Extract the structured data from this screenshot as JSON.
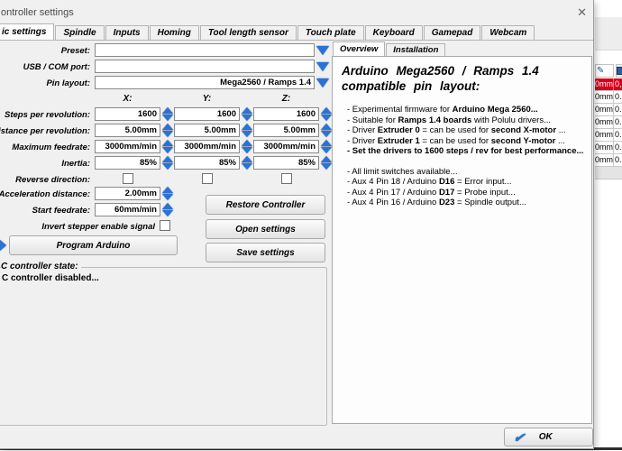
{
  "window": {
    "title": "ontroller settings",
    "close_glyph": "✕"
  },
  "tabs": [
    "ic settings",
    "Spindle",
    "Inputs",
    "Homing",
    "Tool length sensor",
    "Touch plate",
    "Keyboard",
    "Gamepad",
    "Webcam"
  ],
  "form": {
    "preset_label": "Preset:",
    "usb_label": "USB / COM port:",
    "pin_label": "Pin layout:",
    "preset_value": "",
    "usb_value": "",
    "pin_value": "Mega2560 / Ramps 1.4",
    "col_headers": [
      "X:",
      "Y:",
      "Z:"
    ],
    "rows": [
      {
        "label": "Steps per revolution:",
        "values": [
          "1600",
          "1600",
          "1600"
        ]
      },
      {
        "label": "Distance per revolution:",
        "values": [
          "5.00mm",
          "5.00mm",
          "5.00mm"
        ]
      },
      {
        "label": "Maximum feedrate:",
        "values": [
          "3000mm/min",
          "3000mm/min",
          "3000mm/min"
        ]
      },
      {
        "label": "Inertia:",
        "values": [
          "85%",
          "85%",
          "85%"
        ]
      }
    ],
    "reverse_label": "Reverse direction:",
    "accel_label": "Acceleration distance:",
    "accel_value": "2.00mm",
    "start_label": "Start feedrate:",
    "start_value": "60mm/min",
    "invert_label": "Invert stepper enable signal",
    "program_button": "Program Arduino",
    "restore_button": "Restore Controller",
    "open_button": "Open settings",
    "save_button": "Save settings"
  },
  "state_box": {
    "title": "C controller state:",
    "status": "C controller disabled..."
  },
  "info_panel": {
    "tabs": [
      "Overview",
      "Installation"
    ],
    "heading_line1": "Arduino  Mega2560  /  Ramps  1.4",
    "heading_line2": "compatible  pin  layout:",
    "bullets_a": [
      [
        {
          "t": "- Experimental firmware for ",
          "b": 0
        },
        {
          "t": "Arduino  Mega  2560...",
          "b": 1
        }
      ],
      [
        {
          "t": "- Suitable for ",
          "b": 0
        },
        {
          "t": "Ramps 1.4  boards",
          "b": 1
        },
        {
          "t": " with Polulu drivers...",
          "b": 0
        }
      ],
      [
        {
          "t": "- Driver ",
          "b": 0
        },
        {
          "t": "Extruder 0",
          "b": 1
        },
        {
          "t": " = can be used for ",
          "b": 0
        },
        {
          "t": "second X-motor",
          "b": 1
        },
        {
          "t": " ...",
          "b": 0
        }
      ],
      [
        {
          "t": "- Driver ",
          "b": 0
        },
        {
          "t": "Extruder 1",
          "b": 1
        },
        {
          "t": " = can be used for ",
          "b": 0
        },
        {
          "t": "second Y-motor",
          "b": 1
        },
        {
          "t": " ...",
          "b": 0
        }
      ],
      [
        {
          "t": "- Set the drivers to 1600 steps / rev for best performance...",
          "b": 1
        }
      ]
    ],
    "bullets_b": [
      [
        {
          "t": "- All limit switches available...",
          "b": 0
        }
      ],
      [
        {
          "t": "- Aux 4 Pin 18 / Arduino ",
          "b": 0
        },
        {
          "t": "D16",
          "b": 1
        },
        {
          "t": " = Error input...",
          "b": 0
        }
      ],
      [
        {
          "t": "- Aux 4 Pin 17 / Arduino ",
          "b": 0
        },
        {
          "t": "D17",
          "b": 1
        },
        {
          "t": " = Probe input...",
          "b": 0
        }
      ],
      [
        {
          "t": "- Aux 4 Pin 16 / Arduino ",
          "b": 0
        },
        {
          "t": "D23",
          "b": 1
        },
        {
          "t": " = Spindle output...",
          "b": 0
        }
      ]
    ]
  },
  "ok_button": "OK",
  "bg_table": {
    "rows": [
      {
        "c1": "0mm",
        "c2": "0,"
      },
      {
        "c1": "0mm",
        "c2": "0."
      },
      {
        "c1": "0mm",
        "c2": "0."
      },
      {
        "c1": "0mm",
        "c2": "0."
      },
      {
        "c1": "0mm",
        "c2": "0."
      },
      {
        "c1": "0mm",
        "c2": "0."
      },
      {
        "c1": "0mm",
        "c2": "0."
      }
    ]
  },
  "colors": {
    "accent_blue": "#2a72d8",
    "alarm_red": "#d6001c"
  }
}
